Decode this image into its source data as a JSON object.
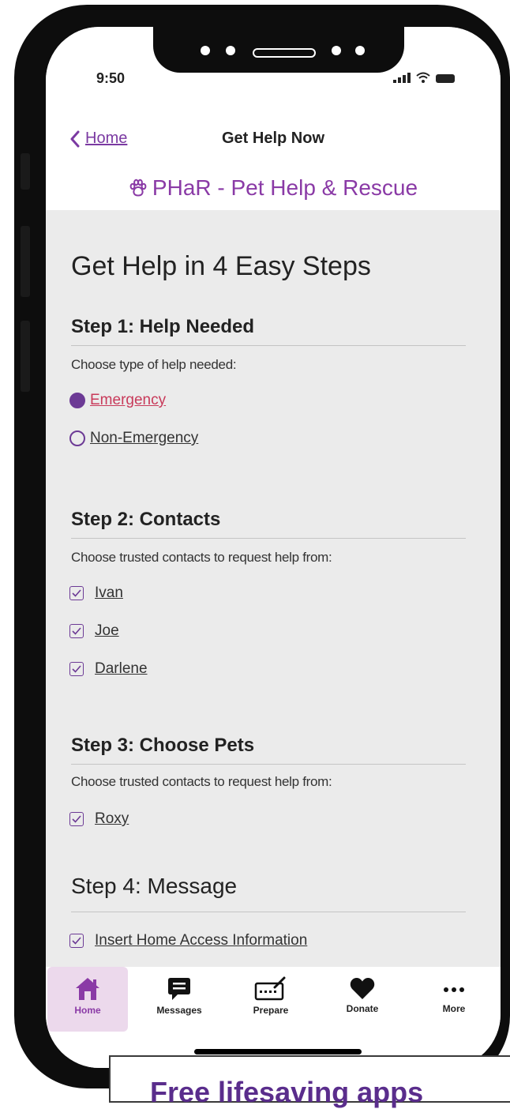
{
  "status_bar": {
    "time": "9:50"
  },
  "nav": {
    "back_label": "Home",
    "title": "Get Help Now"
  },
  "brand": {
    "name": "PHaR - Pet Help & Rescue"
  },
  "page": {
    "heading": "Get Help in 4 Easy Steps"
  },
  "steps": [
    {
      "title": "Step 1:  Help Needed",
      "description": "Choose type of help needed:",
      "options": [
        {
          "label": "Emergency",
          "selected": true
        },
        {
          "label": "Non-Emergency",
          "selected": false
        }
      ]
    },
    {
      "title": "Step 2:  Contacts",
      "description": "Choose trusted contacts to request help from:",
      "options": [
        {
          "label": "Ivan",
          "checked": true
        },
        {
          "label": "Joe",
          "checked": true
        },
        {
          "label": "Darlene",
          "checked": true
        }
      ]
    },
    {
      "title": "Step 3:  Choose Pets",
      "description": "Choose trusted contacts to request help from:",
      "options": [
        {
          "label": "Roxy",
          "checked": true
        }
      ]
    },
    {
      "title": "Step 4: Message",
      "options": [
        {
          "label": "Insert Home Access Information",
          "checked": true
        }
      ]
    }
  ],
  "tabbar": {
    "active": "Home",
    "items": [
      {
        "label": "Home",
        "icon": "home-icon"
      },
      {
        "label": "Messages",
        "icon": "message-icon"
      },
      {
        "label": "Prepare",
        "icon": "prepare-icon"
      },
      {
        "label": "Donate",
        "icon": "heart-icon"
      },
      {
        "label": "More",
        "icon": "more-icon"
      }
    ]
  },
  "banner": {
    "text": "Free lifesaving apps"
  },
  "colors": {
    "accent": "#8a3aa6",
    "control": "#6c3a95",
    "emergency": "#c83a5a",
    "background": "#ebebeb"
  }
}
